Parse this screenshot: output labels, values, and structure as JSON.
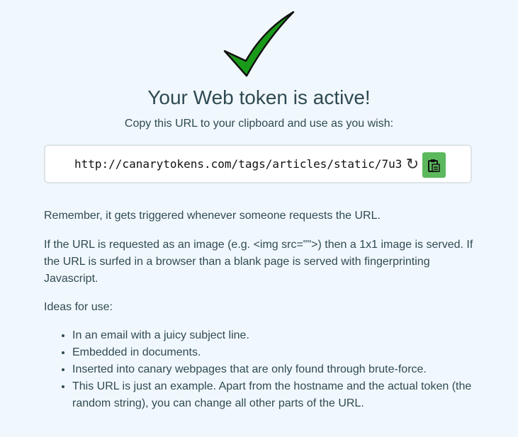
{
  "header": {
    "title": "Your Web token is active!",
    "subtitle": "Copy this URL to your clipboard and use as you wish:"
  },
  "token": {
    "url": "http://canarytokens.com/tags/articles/static/7u3",
    "refresh_icon": "refresh-icon",
    "copy_icon": "clipboard-icon",
    "copy_button_color": "#5cb85c"
  },
  "info": {
    "remember": "Remember, it gets triggered whenever someone requests the URL.",
    "image_note": "If the URL is requested as an image (e.g. <img src=\"\">) then a 1x1 image is served. If the URL is surfed in a browser than a blank page is served with fingerprinting Javascript.",
    "ideas_heading": "Ideas for use:",
    "ideas": [
      "In an email with a juicy subject line.",
      "Embedded in documents.",
      "Inserted into canary webpages that are only found through brute-force.",
      "This URL is just an example. Apart from the hostname and the actual token (the random string), you can change all other parts of the URL."
    ]
  },
  "colors": {
    "background": "#f1f8fd",
    "text": "#2f4a52",
    "checkmark": "#1a9a1a"
  }
}
